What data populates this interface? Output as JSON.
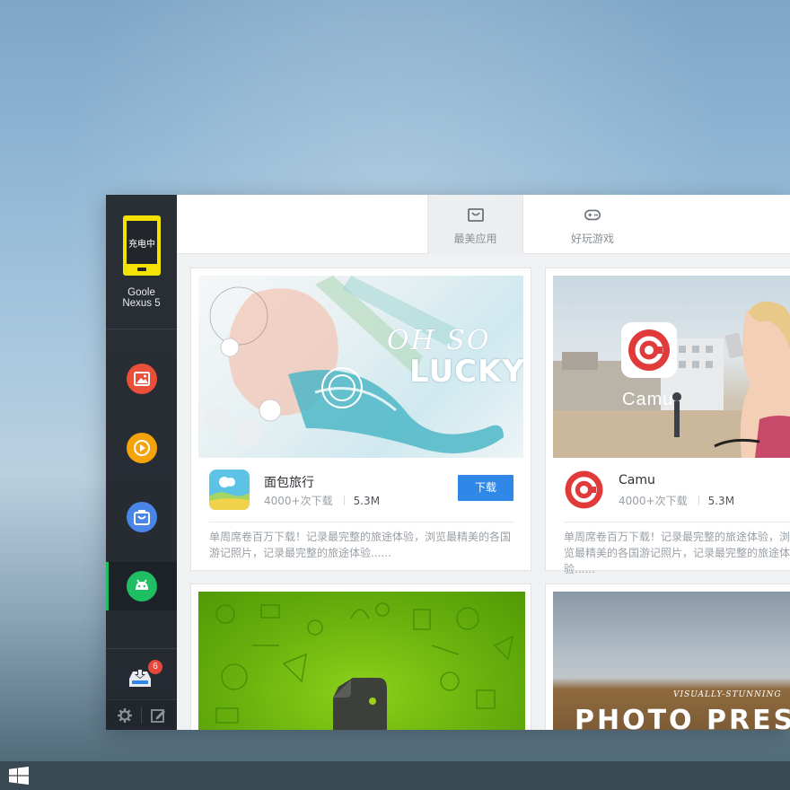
{
  "device": {
    "status": "充电中",
    "name_line1": "Goole",
    "name_line2": "Nexus 5"
  },
  "sidebar": {
    "items": [
      {
        "name": "photos",
        "color": "#e94f39",
        "icon": "image-icon"
      },
      {
        "name": "videos",
        "color": "#f4a40a",
        "icon": "play-icon"
      },
      {
        "name": "store",
        "color": "#4a86e8",
        "icon": "shopping-bag-icon"
      },
      {
        "name": "apps",
        "color": "#1fbe63",
        "icon": "android-icon",
        "active": true
      }
    ],
    "downloads_badge": "6",
    "footer": {
      "settings_icon": "gear-icon",
      "feedback_icon": "edit-icon"
    }
  },
  "tabs": [
    {
      "label": "最美应用",
      "icon": "bag-icon",
      "active": true
    },
    {
      "label": "好玩游戏",
      "icon": "gamepad-icon",
      "active": false
    }
  ],
  "cards": [
    {
      "title": "面包旅行",
      "downloads": "4000+次下载",
      "size": "5.3M",
      "button": "下载",
      "description": "单周席卷百万下载！记录最完整的旅途体验，浏览最精美的各国游记照片，记录最完整的旅途体验......",
      "banner_text_1": "OH SO",
      "banner_text_2": "LUCKY"
    },
    {
      "title": "Camu",
      "downloads": "4000+次下载",
      "size": "5.3M",
      "description": "单周席卷百万下载！记录最完整的旅途体验，浏览最精美的各国游记照片，记录最完整的旅途体验......",
      "banner_text": "Camu"
    },
    {
      "banner_icon": "evernote-icon"
    },
    {
      "banner_text_small": "VISUALLY-STUNNING",
      "banner_text_large": "PHOTO PRES"
    }
  ],
  "colors": {
    "accent_blue": "#2f88e8",
    "sidebar_bg": "#2a2f36",
    "active_green": "#1fbe63",
    "badge_red": "#e7463b"
  }
}
